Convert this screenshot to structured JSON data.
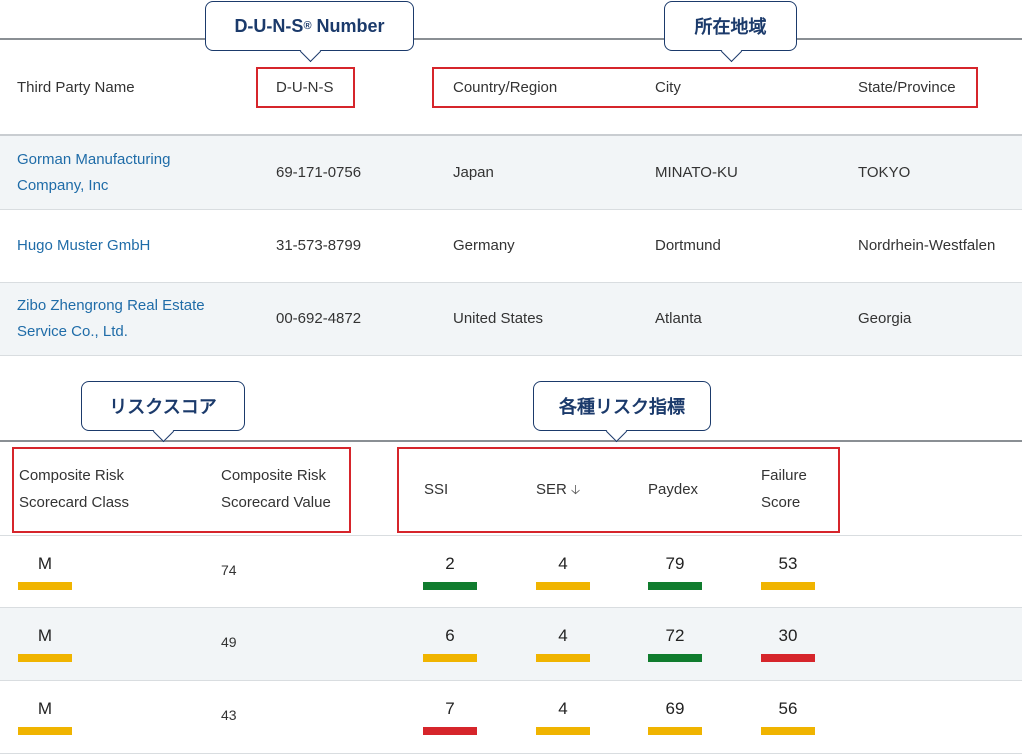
{
  "callouts": {
    "duns": {
      "label": "D-U-N-S",
      "reg": "®",
      "suffix": " Number"
    },
    "region": "所在地域",
    "risk_score": "リスクスコア",
    "indicators": "各種リスク指標"
  },
  "table1": {
    "headers": [
      "Third Party Name",
      "D-U-N-S",
      "Country/Region",
      "City",
      "State/Province"
    ],
    "rows": [
      {
        "name_line1": "Gorman Manufacturing",
        "name_line2": "Company, Inc",
        "duns": "69-171-0756",
        "country": "Japan",
        "city": "MINATO-KU",
        "state": "TOKYO"
      },
      {
        "name_line1": "Hugo Muster GmbH",
        "name_line2": "",
        "duns": "31-573-8799",
        "country": "Germany",
        "city": "Dortmund",
        "state": "Nordrhein-Westfalen"
      },
      {
        "name_line1": "Zibo Zhengrong Real Estate",
        "name_line2": "Service Co., Ltd.",
        "duns": "00-692-4872",
        "country": "United States",
        "city": "Atlanta",
        "state": "Georgia"
      }
    ]
  },
  "table2": {
    "headers": {
      "class_line1": "Composite Risk",
      "class_line2": "Scorecard Class",
      "value_line1": "Composite Risk",
      "value_line2": "Scorecard Value",
      "ssi": "SSI",
      "ser": "SER",
      "ser_sort_icon": "arrow-down-icon",
      "paydex": "Paydex",
      "failure_line1": "Failure",
      "failure_line2": "Score"
    },
    "rows": [
      {
        "class": "M",
        "class_color": "#f0b400",
        "value": "74",
        "ssi": "2",
        "ssi_color": "#107c2e",
        "ser": "4",
        "ser_color": "#f0b400",
        "paydex": "79",
        "paydex_color": "#107c2e",
        "failure": "53",
        "failure_color": "#f0b400"
      },
      {
        "class": "M",
        "class_color": "#f0b400",
        "value": "49",
        "ssi": "6",
        "ssi_color": "#f0b400",
        "ser": "4",
        "ser_color": "#f0b400",
        "paydex": "72",
        "paydex_color": "#107c2e",
        "failure": "30",
        "failure_color": "#d6252b"
      },
      {
        "class": "M",
        "class_color": "#f0b400",
        "value": "43",
        "ssi": "7",
        "ssi_color": "#d6252b",
        "ser": "4",
        "ser_color": "#f0b400",
        "paydex": "69",
        "paydex_color": "#f0b400",
        "failure": "56",
        "failure_color": "#f0b400"
      }
    ]
  },
  "colors": {
    "accent_red": "#d6252b",
    "callout_navy": "#1b3a6b",
    "link_blue": "#1f6ca8",
    "row_alt": "#f2f5f7"
  }
}
